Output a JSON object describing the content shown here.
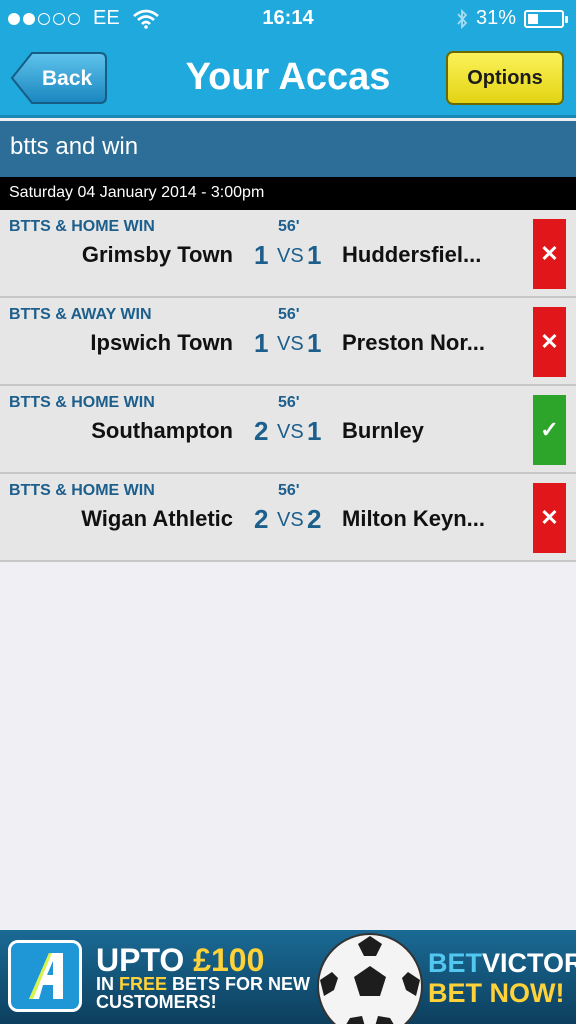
{
  "status_bar": {
    "carrier": "EE",
    "time": "16:14",
    "battery": "31%",
    "battery_level": 0.31
  },
  "nav": {
    "back_label": "Back",
    "title": "Your Accas",
    "options_label": "Options"
  },
  "acca": {
    "name": "btts and win",
    "date": "Saturday 04 January 2014 - 3:00pm"
  },
  "matches": [
    {
      "bet_type": "BTTS & HOME WIN",
      "minute": "56'",
      "home": "Grimsby Town",
      "home_score": "1",
      "vs": "VS",
      "away_score": "1",
      "away": "Huddersfiel...",
      "status": "lost",
      "status_icon": "✕",
      "status_color": "#e0161b"
    },
    {
      "bet_type": "BTTS & AWAY WIN",
      "minute": "56'",
      "home": "Ipswich Town",
      "home_score": "1",
      "vs": "VS",
      "away_score": "1",
      "away": "Preston Nor...",
      "status": "lost",
      "status_icon": "✕",
      "status_color": "#e0161b"
    },
    {
      "bet_type": "BTTS & HOME WIN",
      "minute": "56'",
      "home": "Southampton",
      "home_score": "2",
      "vs": "VS",
      "away_score": "1",
      "away": "Burnley",
      "status": "won",
      "status_icon": "✓",
      "status_color": "#2da52a"
    },
    {
      "bet_type": "BTTS & HOME WIN",
      "minute": "56'",
      "home": "Wigan Athletic",
      "home_score": "2",
      "vs": "VS",
      "away_score": "2",
      "away": "Milton Keyn...",
      "status": "lost",
      "status_icon": "✕",
      "status_color": "#e0161b"
    }
  ],
  "banner": {
    "promo_upto": "UPTO ",
    "promo_amount": "£100",
    "promo_in": "IN ",
    "promo_free": "FREE",
    "promo_rest": " BETS FOR NEW",
    "promo_customers": "CUSTOMERS!",
    "brand_bet": "BET",
    "brand_victor": "VICTOR",
    "cta": "BET NOW!"
  }
}
